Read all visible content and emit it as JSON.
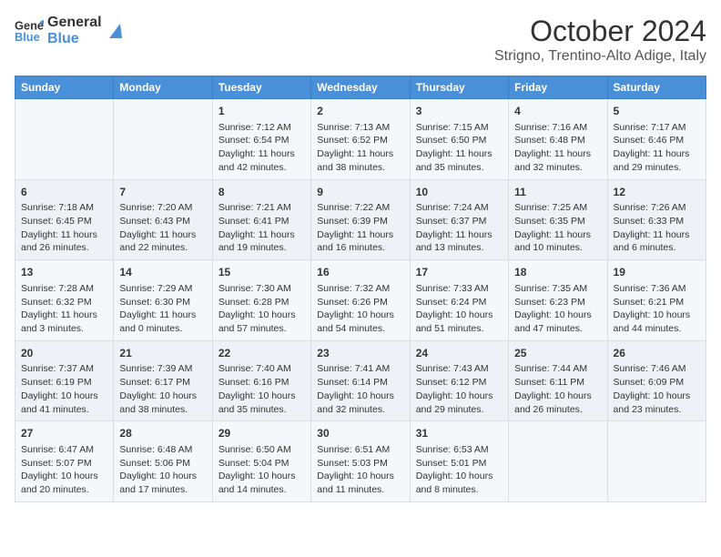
{
  "header": {
    "logo_line1": "General",
    "logo_line2": "Blue",
    "month": "October 2024",
    "location": "Strigno, Trentino-Alto Adige, Italy"
  },
  "days_of_week": [
    "Sunday",
    "Monday",
    "Tuesday",
    "Wednesday",
    "Thursday",
    "Friday",
    "Saturday"
  ],
  "weeks": [
    [
      {
        "day": "",
        "content": ""
      },
      {
        "day": "",
        "content": ""
      },
      {
        "day": "1",
        "content": "Sunrise: 7:12 AM\nSunset: 6:54 PM\nDaylight: 11 hours and 42 minutes."
      },
      {
        "day": "2",
        "content": "Sunrise: 7:13 AM\nSunset: 6:52 PM\nDaylight: 11 hours and 38 minutes."
      },
      {
        "day": "3",
        "content": "Sunrise: 7:15 AM\nSunset: 6:50 PM\nDaylight: 11 hours and 35 minutes."
      },
      {
        "day": "4",
        "content": "Sunrise: 7:16 AM\nSunset: 6:48 PM\nDaylight: 11 hours and 32 minutes."
      },
      {
        "day": "5",
        "content": "Sunrise: 7:17 AM\nSunset: 6:46 PM\nDaylight: 11 hours and 29 minutes."
      }
    ],
    [
      {
        "day": "6",
        "content": "Sunrise: 7:18 AM\nSunset: 6:45 PM\nDaylight: 11 hours and 26 minutes."
      },
      {
        "day": "7",
        "content": "Sunrise: 7:20 AM\nSunset: 6:43 PM\nDaylight: 11 hours and 22 minutes."
      },
      {
        "day": "8",
        "content": "Sunrise: 7:21 AM\nSunset: 6:41 PM\nDaylight: 11 hours and 19 minutes."
      },
      {
        "day": "9",
        "content": "Sunrise: 7:22 AM\nSunset: 6:39 PM\nDaylight: 11 hours and 16 minutes."
      },
      {
        "day": "10",
        "content": "Sunrise: 7:24 AM\nSunset: 6:37 PM\nDaylight: 11 hours and 13 minutes."
      },
      {
        "day": "11",
        "content": "Sunrise: 7:25 AM\nSunset: 6:35 PM\nDaylight: 11 hours and 10 minutes."
      },
      {
        "day": "12",
        "content": "Sunrise: 7:26 AM\nSunset: 6:33 PM\nDaylight: 11 hours and 6 minutes."
      }
    ],
    [
      {
        "day": "13",
        "content": "Sunrise: 7:28 AM\nSunset: 6:32 PM\nDaylight: 11 hours and 3 minutes."
      },
      {
        "day": "14",
        "content": "Sunrise: 7:29 AM\nSunset: 6:30 PM\nDaylight: 11 hours and 0 minutes."
      },
      {
        "day": "15",
        "content": "Sunrise: 7:30 AM\nSunset: 6:28 PM\nDaylight: 10 hours and 57 minutes."
      },
      {
        "day": "16",
        "content": "Sunrise: 7:32 AM\nSunset: 6:26 PM\nDaylight: 10 hours and 54 minutes."
      },
      {
        "day": "17",
        "content": "Sunrise: 7:33 AM\nSunset: 6:24 PM\nDaylight: 10 hours and 51 minutes."
      },
      {
        "day": "18",
        "content": "Sunrise: 7:35 AM\nSunset: 6:23 PM\nDaylight: 10 hours and 47 minutes."
      },
      {
        "day": "19",
        "content": "Sunrise: 7:36 AM\nSunset: 6:21 PM\nDaylight: 10 hours and 44 minutes."
      }
    ],
    [
      {
        "day": "20",
        "content": "Sunrise: 7:37 AM\nSunset: 6:19 PM\nDaylight: 10 hours and 41 minutes."
      },
      {
        "day": "21",
        "content": "Sunrise: 7:39 AM\nSunset: 6:17 PM\nDaylight: 10 hours and 38 minutes."
      },
      {
        "day": "22",
        "content": "Sunrise: 7:40 AM\nSunset: 6:16 PM\nDaylight: 10 hours and 35 minutes."
      },
      {
        "day": "23",
        "content": "Sunrise: 7:41 AM\nSunset: 6:14 PM\nDaylight: 10 hours and 32 minutes."
      },
      {
        "day": "24",
        "content": "Sunrise: 7:43 AM\nSunset: 6:12 PM\nDaylight: 10 hours and 29 minutes."
      },
      {
        "day": "25",
        "content": "Sunrise: 7:44 AM\nSunset: 6:11 PM\nDaylight: 10 hours and 26 minutes."
      },
      {
        "day": "26",
        "content": "Sunrise: 7:46 AM\nSunset: 6:09 PM\nDaylight: 10 hours and 23 minutes."
      }
    ],
    [
      {
        "day": "27",
        "content": "Sunrise: 6:47 AM\nSunset: 5:07 PM\nDaylight: 10 hours and 20 minutes."
      },
      {
        "day": "28",
        "content": "Sunrise: 6:48 AM\nSunset: 5:06 PM\nDaylight: 10 hours and 17 minutes."
      },
      {
        "day": "29",
        "content": "Sunrise: 6:50 AM\nSunset: 5:04 PM\nDaylight: 10 hours and 14 minutes."
      },
      {
        "day": "30",
        "content": "Sunrise: 6:51 AM\nSunset: 5:03 PM\nDaylight: 10 hours and 11 minutes."
      },
      {
        "day": "31",
        "content": "Sunrise: 6:53 AM\nSunset: 5:01 PM\nDaylight: 10 hours and 8 minutes."
      },
      {
        "day": "",
        "content": ""
      },
      {
        "day": "",
        "content": ""
      }
    ]
  ]
}
